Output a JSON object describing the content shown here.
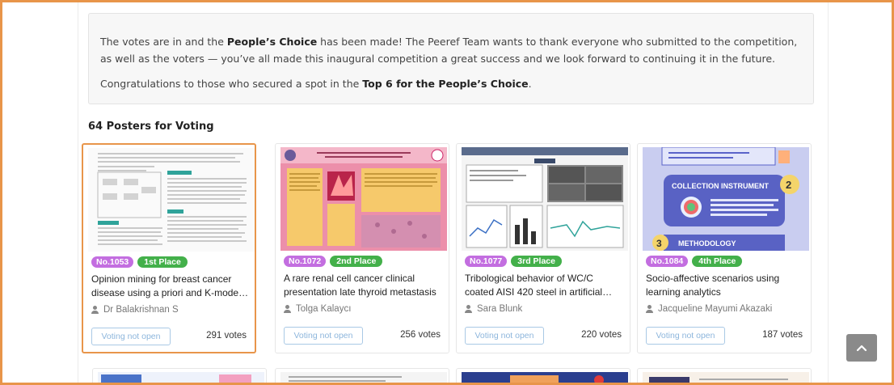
{
  "notice": {
    "p1_a": "The votes are in and the ",
    "p1_b": "People’s Choice",
    "p1_c": " has been made! The Peeref Team wants to thank everyone who submitted to the competition, as well as the voters — you’ve all made this inaugural competition a great success and we look forward to continuing it in the future.",
    "p2_a": "Congratulations to those who secured a spot in the ",
    "p2_b": "Top 6 for the People’s Choice",
    "p2_c": "."
  },
  "section_title": "64 Posters for Voting",
  "cards": [
    {
      "no": "No.1053",
      "place": "1st Place",
      "title": "Opinion mining for breast cancer disease using a priori and K-modes clustering",
      "author": "Dr Balakrishnan S",
      "button": "Voting not open",
      "votes": "291 votes"
    },
    {
      "no": "No.1072",
      "place": "2nd Place",
      "title": "A rare renal cell cancer clinical presentation late thyroid metastasis",
      "author": "Tolga Kalaycı",
      "button": "Voting not open",
      "votes": "256 votes"
    },
    {
      "no": "No.1077",
      "place": "3rd Place",
      "title": "Tribological behavior of WC/C coated AISI 420 steel in artificial saliva",
      "author": "Sara Blunk",
      "button": "Voting not open",
      "votes": "220 votes"
    },
    {
      "no": "No.1084",
      "place": "4th Place",
      "title": "Socio-affective scenarios using learning analytics",
      "author": "Jacqueline Mayumi Akazaki",
      "button": "Voting not open",
      "votes": "187 votes"
    }
  ],
  "poster4": {
    "heading1": "COLLECTION INSTRUMENT",
    "num1": "2",
    "heading2": "METHODOLOGY",
    "num2": "3"
  },
  "icons": {
    "scroll_top": "chevron-up-icon",
    "author": "person-icon"
  },
  "colors": {
    "accent": "#e8954a",
    "badge_no": "#c36ee0",
    "badge_place": "#43b04a",
    "button_border": "#a9c9e5"
  }
}
